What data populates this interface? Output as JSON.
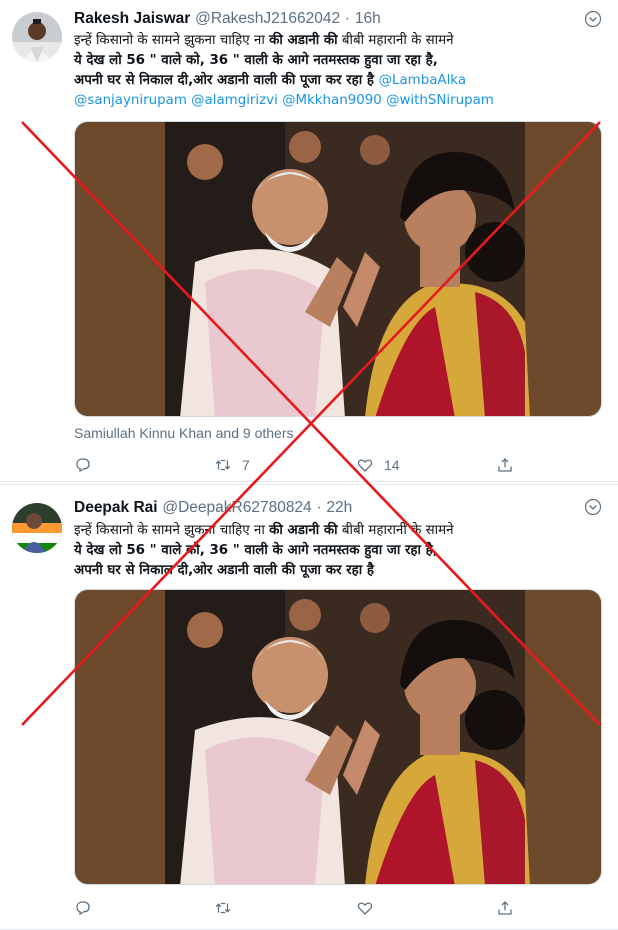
{
  "colors": {
    "link": "#1b95e0",
    "meta": "#5b7083",
    "cross": "#e8191c"
  },
  "tweets": [
    {
      "name": "Rakesh Jaiswar",
      "handle": "@RakeshJ21662042",
      "dot": "·",
      "time": "16h",
      "text_line1_a": "इन्हें किसानो के सामने झुकना चाहिए ना ",
      "text_line1_b": "की अडानी की",
      "text_line1_c": " बीबी महारानी के सामने",
      "text_line2": "ये देख लो 56 \" वाले को, 36 \" वाली के आगे नतमस्तक हुवा जा रहा है,",
      "text_line3_a": "अपनी घर से निकाल दी,ओर अडानी वाली की पूजा कर रहा है ",
      "mention_1": "@LambaAlka",
      "mention_2": "@sanjaynirupam",
      "mention_3": "@alamgirizvi",
      "mention_4": "@Mkkhan9090",
      "mention_5": "@withSNirupam",
      "tagline": "Samiullah Kinnu Khan and 9 others",
      "reply_icon": "reply-icon",
      "retweet_count": "7",
      "like_count": "14"
    },
    {
      "name": "Deepak Rai",
      "handle": "@DeepakR62780824",
      "dot": "·",
      "time": "22h",
      "text_line1_a": "इन्हें किसानो के सामने झुकना चाहिए ना ",
      "text_line1_b": "की अडानी की",
      "text_line1_c": " बीबी महारानी के सामने",
      "text_line2": "ये देख लो 56 \" वाले को, 36 \" वाली के आगे नतमस्तक हुवा जा रहा है,",
      "text_line3": "अपनी घर से निकाल दी,ओर अडानी वाली की पूजा कर रहा है"
    }
  ]
}
